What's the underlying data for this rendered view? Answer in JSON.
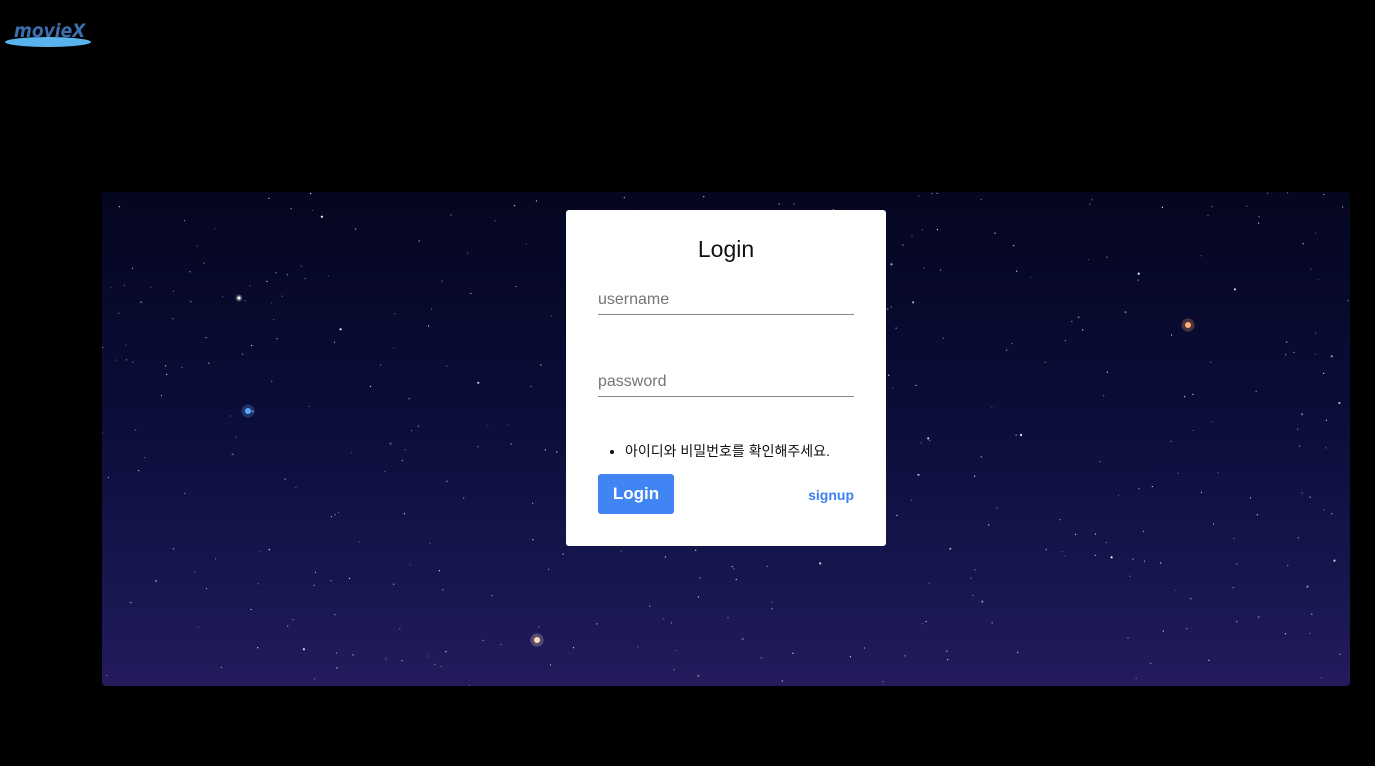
{
  "brand": {
    "name": "movieX",
    "text_color": "#3b6fb0",
    "ellipse_color": "#5ab3ec"
  },
  "login": {
    "title": "Login",
    "username_placeholder": "username",
    "password_placeholder": "password",
    "error_message": "아이디와 비밀번호를 확인해주세요.",
    "login_button": "Login",
    "signup_link": "signup",
    "accent_color": "#4185f4"
  }
}
